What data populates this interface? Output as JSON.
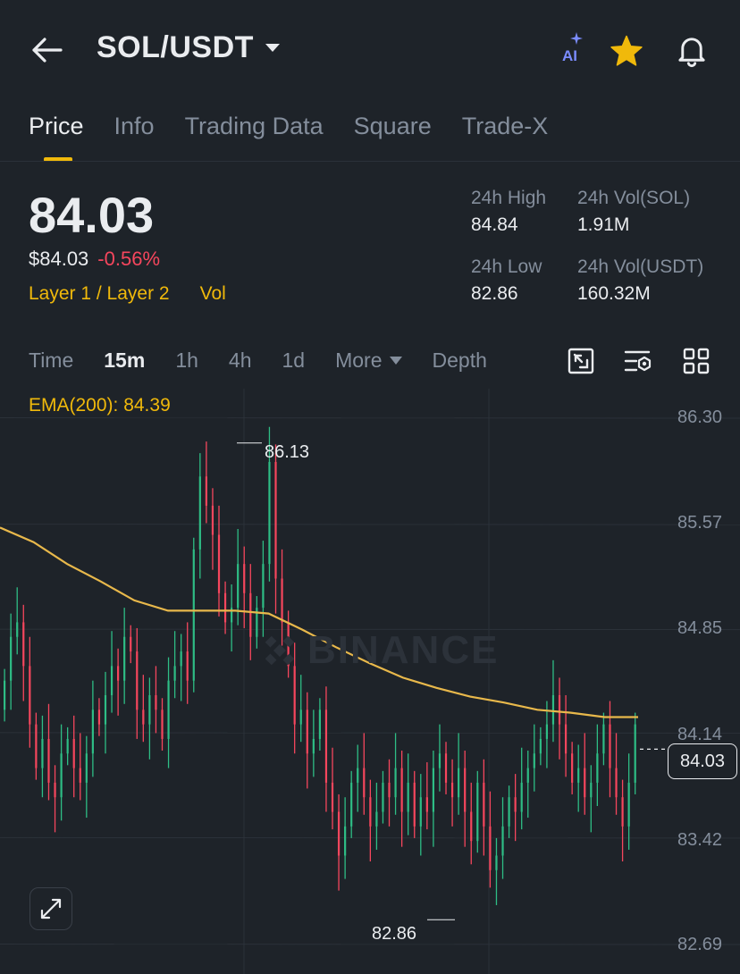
{
  "header": {
    "pair": "SOL/USDT",
    "ai_label": "AI"
  },
  "tabs": [
    {
      "label": "Price",
      "active": true
    },
    {
      "label": "Info"
    },
    {
      "label": "Trading Data"
    },
    {
      "label": "Square"
    },
    {
      "label": "Trade-X"
    }
  ],
  "price": {
    "last": "84.03",
    "usd": "$84.03",
    "change_pct": "-0.56%",
    "tag_category": "Layer 1 / Layer 2",
    "tag_vol": "Vol"
  },
  "stats": {
    "high_label": "24h High",
    "high_value": "84.84",
    "low_label": "24h Low",
    "low_value": "82.86",
    "vol_sol_label": "24h Vol(SOL)",
    "vol_sol_value": "1.91M",
    "vol_usdt_label": "24h Vol(USDT)",
    "vol_usdt_value": "160.32M"
  },
  "intervals": [
    {
      "label": "Time"
    },
    {
      "label": "15m",
      "active": true
    },
    {
      "label": "1h"
    },
    {
      "label": "4h"
    },
    {
      "label": "1d"
    },
    {
      "label": "More"
    },
    {
      "label": "Depth"
    }
  ],
  "toolbar_icons": [
    "chart-settings-icon",
    "indicator-icon",
    "grid-layout-icon"
  ],
  "chart": {
    "ema_label": "EMA(200): 84.39",
    "watermark": "BINANCE",
    "current_price": "84.03",
    "high_marker": "86.13",
    "low_marker": "82.86",
    "y_ticks": [
      "86.30",
      "85.57",
      "84.85",
      "84.14",
      "83.42",
      "82.69"
    ]
  },
  "colors": {
    "background": "#1e2329",
    "up": "#2ebd85",
    "down": "#f6465d",
    "accent": "#f0b90b",
    "muted": "#848e9c"
  },
  "chart_data": {
    "type": "candlestick",
    "ylim": [
      82.69,
      86.3
    ],
    "y_ticks": [
      86.3,
      85.57,
      84.85,
      84.14,
      83.42,
      82.69
    ],
    "series": [
      {
        "name": "EMA(200)",
        "values": [
          85.55,
          85.45,
          85.3,
          85.18,
          85.05,
          84.98,
          84.98,
          84.98,
          84.96,
          84.85,
          84.73,
          84.62,
          84.52,
          84.45,
          84.39,
          84.35,
          84.3,
          84.28,
          84.25,
          84.25
        ]
      }
    ],
    "high": 86.13,
    "low": 82.86,
    "last": 84.03
  }
}
